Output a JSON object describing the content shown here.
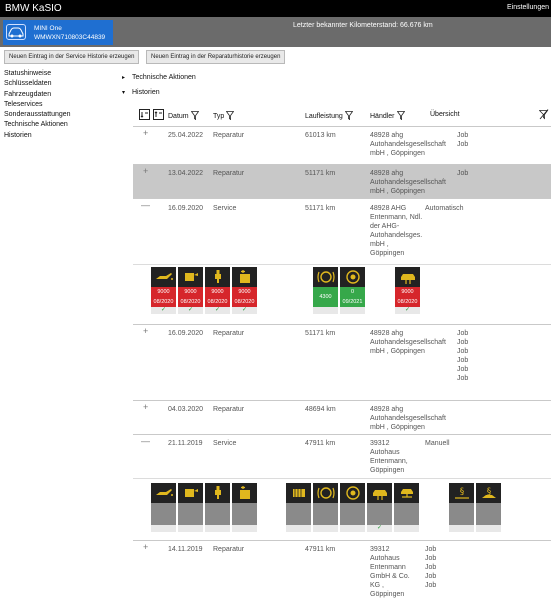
{
  "app": {
    "title": "BMW KaSIO",
    "settings_label": "Einstellungen"
  },
  "vehicle": {
    "model": "MINI One",
    "vin": "WMWXN710803C44839",
    "mileage_text": "Letzter bekannter Kilometerstand: 66.676 km"
  },
  "actions": {
    "service_entry": "Neuen Eintrag in der Service Historie erzeugen",
    "repair_entry": "Neuen Eintrag in der Reparaturhistorie erzeugen"
  },
  "sidebar": {
    "items": [
      {
        "label": "Statushinweise"
      },
      {
        "label": "Schlüsseldaten"
      },
      {
        "label": "Fahrzeugdaten"
      },
      {
        "label": "Teleservices"
      },
      {
        "label": "Sonderausstattungen"
      },
      {
        "label": "Technische Aktionen"
      },
      {
        "label": "Historien"
      }
    ]
  },
  "sections": {
    "technical": "Technische Aktionen",
    "history": "Historien"
  },
  "columns": {
    "date": "Datum",
    "type": "Typ",
    "mileage": "Laufleistung",
    "dealer": "Händler",
    "overview": "Übersicht"
  },
  "rows": [
    {
      "toggle": "+",
      "date": "25.04.2022",
      "type": "Reparatur",
      "mileage": "61013 km",
      "dealer": [
        "48928 ahg",
        "Autohandelsgesellschaft",
        "mbH , Göppingen"
      ],
      "overview": [
        "Job",
        "Job"
      ]
    },
    {
      "toggle": "+",
      "date": "13.04.2022",
      "type": "Reparatur",
      "mileage": "51171 km",
      "dealer": [
        "48928 ahg",
        "Autohandelsgesellschaft",
        "mbH , Göppingen"
      ],
      "overview": [
        "Job"
      ]
    },
    {
      "toggle": "—",
      "date": "16.09.2020",
      "type": "Service",
      "mileage": "51171 km",
      "dealer": [
        "48928 AHG",
        "Entenmann, Ndl.",
        "der AHG-",
        "Autohandelsges.",
        "mbH ,",
        "Göppingen"
      ],
      "overview": [
        "Automatisch"
      ]
    },
    {
      "toggle": "+",
      "date": "16.09.2020",
      "type": "Reparatur",
      "mileage": "51171 km",
      "dealer": [
        "48928 ahg",
        "Autohandelsgesellschaft",
        "mbH , Göppingen"
      ],
      "overview": [
        "Job",
        "Job",
        "Job",
        "Job",
        "Job",
        "Job"
      ]
    },
    {
      "toggle": "+",
      "date": "04.03.2020",
      "type": "Reparatur",
      "mileage": "48694 km",
      "dealer": [
        "48928 ahg",
        "Autohandelsgesellschaft",
        "mbH , Göppingen"
      ],
      "overview": []
    },
    {
      "toggle": "—",
      "date": "21.11.2019",
      "type": "Service",
      "mileage": "47911 km",
      "dealer": [
        "39312",
        "Autohaus",
        "Entenmann,",
        "Göppingen"
      ],
      "overview": [
        "Manuell"
      ]
    },
    {
      "toggle": "+",
      "date": "14.11.2019",
      "type": "Reparatur",
      "mileage": "47911 km",
      "dealer": [
        "39312",
        "Autohaus",
        "Entenmann",
        "GmbH & Co.",
        "KG ,",
        "Göppingen"
      ],
      "overview": [
        "Job",
        "Job",
        "Job",
        "Job",
        "Job"
      ]
    }
  ],
  "service_tiles_2020": [
    {
      "icon": "oil-can-icon",
      "value": "9000",
      "date": "08/2020",
      "status": "red",
      "check": "✓"
    },
    {
      "icon": "oil-filter-icon",
      "value": "9000",
      "date": "08/2020",
      "status": "red",
      "check": "✓"
    },
    {
      "icon": "spark-plug-icon",
      "value": "9000",
      "date": "08/2020",
      "status": "red",
      "check": "✓"
    },
    {
      "icon": "brake-fluid-icon",
      "value": "9000",
      "date": "08/2020",
      "status": "red",
      "check": "✓"
    },
    {
      "icon": "brake-front-icon",
      "value": "4300",
      "date": "",
      "status": "green",
      "check": ""
    },
    {
      "icon": "brake-rear-icon",
      "value": "0",
      "date": "09/2021",
      "status": "green",
      "check": ""
    },
    {
      "icon": "vehicle-check-icon",
      "value": "9000",
      "date": "08/2020",
      "status": "red",
      "check": "✓"
    }
  ],
  "service_tiles_2019": [
    {
      "icon": "oil-can-icon",
      "check": ""
    },
    {
      "icon": "oil-filter-icon",
      "check": ""
    },
    {
      "icon": "spark-plug-icon",
      "check": ""
    },
    {
      "icon": "brake-fluid-icon",
      "check": ""
    },
    {
      "icon": "microfilter-icon",
      "check": ""
    },
    {
      "icon": "brake-front-icon",
      "check": ""
    },
    {
      "icon": "brake-rear-icon",
      "check": ""
    },
    {
      "icon": "vehicle-check-icon",
      "check": "✓"
    },
    {
      "icon": "vehicle-lift-icon",
      "check": ""
    },
    {
      "icon": "emission-test-icon",
      "check": ""
    },
    {
      "icon": "inspection-icon",
      "check": ""
    }
  ]
}
